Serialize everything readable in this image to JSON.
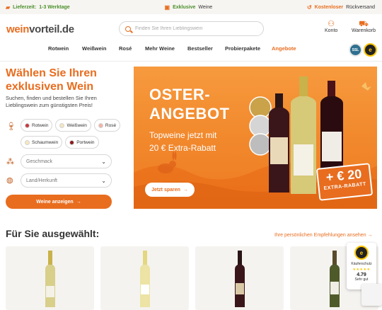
{
  "topbar": {
    "delivery_prefix": "Lieferzeit:",
    "delivery_value": "1-3 Werktage",
    "exclusive_strong": "Exklusive",
    "exclusive_rest": "Weine",
    "returns_strong": "Kostenloser",
    "returns_rest": "Rückversand"
  },
  "header": {
    "logo_part1": "wein",
    "logo_part2": "vorteil",
    "logo_part3": ".de",
    "search_placeholder": "Finden Sie Ihren Lieblingswein",
    "account_label": "Konto",
    "cart_label": "Warenkorb"
  },
  "nav": {
    "items": [
      {
        "label": "Rotwein"
      },
      {
        "label": "Weißwein"
      },
      {
        "label": "Rosé"
      },
      {
        "label": "Mehr Weine"
      },
      {
        "label": "Bestseller"
      },
      {
        "label": "Probierpakete"
      },
      {
        "label": "Angebote"
      }
    ]
  },
  "trust_badges": {
    "ssl": "SSL",
    "trusted": "e"
  },
  "finder": {
    "title": "Wählen Sie Ihren exklusiven Wein",
    "subtitle": "Suchen, finden und bestellen Sie Ihren Lieblingswein zum günstigsten Preis!",
    "wine_types": [
      {
        "label": "Rotwein",
        "color": "#c8383f"
      },
      {
        "label": "Weißwein",
        "color": "#f2e6c2"
      },
      {
        "label": "Rosé",
        "color": "#f4b3a3"
      },
      {
        "label": "Schaumwein",
        "color": "#f7e9bb"
      },
      {
        "label": "Portwein",
        "color": "#8b1a1a"
      }
    ],
    "taste_placeholder": "Geschmack",
    "origin_placeholder": "Land/Herkunft",
    "submit_label": "Weine anzeigen",
    "arrow": "→"
  },
  "banner": {
    "title_line1": "OSTER-",
    "title_line2": "ANGEBOT",
    "subtitle_line1": "Topweine jetzt mit",
    "subtitle_line2": "20 € Extra-Rabatt",
    "button_label": "Jetzt sparen",
    "arrow": "→",
    "rebate_amount": "+ € 20",
    "rebate_label": "EXTRA-RABATT",
    "bottle_labels": [
      "Château Pieux Brossais",
      "Montagny",
      "Clos Sainte"
    ],
    "medal_labels": [
      "GOLD",
      "MUNDUS VINI",
      ""
    ]
  },
  "recommendations": {
    "title": "Für Sie ausgewählt:",
    "link_label": "Ihre persönlichen Empfehlungen ansehen",
    "arrow": "→"
  },
  "trust_widget": {
    "label": "Käuferschutz",
    "score": "4.79",
    "rating_text": "Sehr gut",
    "stars": "★★★★★"
  },
  "colors": {
    "accent": "#e86d1f",
    "green": "#4a8f2a"
  }
}
